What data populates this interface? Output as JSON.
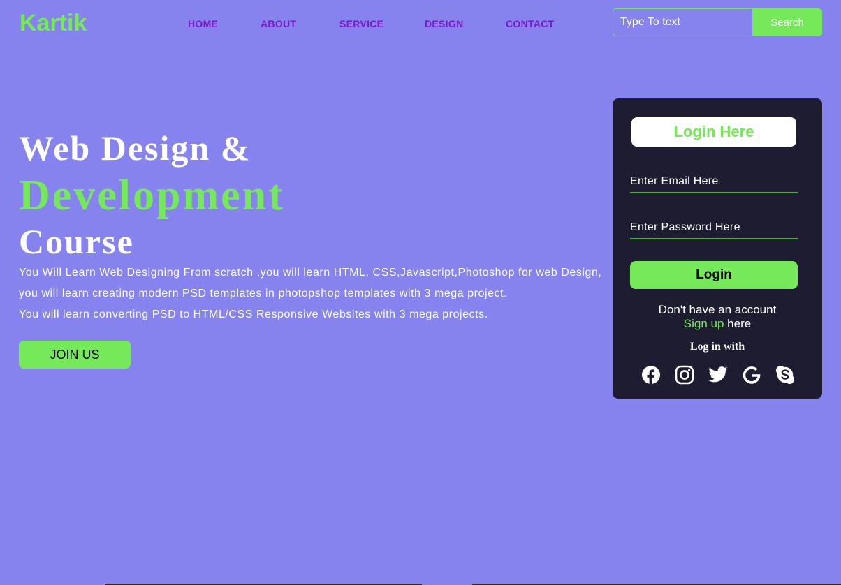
{
  "brand": {
    "logo": "Kartik"
  },
  "nav": {
    "items": [
      {
        "label": "HOME"
      },
      {
        "label": "ABOUT"
      },
      {
        "label": "SERVICE"
      },
      {
        "label": "DESIGN"
      },
      {
        "label": "CONTACT"
      }
    ]
  },
  "search": {
    "placeholder": "Type To text",
    "button_label": "Search"
  },
  "hero": {
    "line1": "Web Design &",
    "line2": "Development",
    "line3": "Course",
    "description": [
      "You Will Learn Web Designing From scratch ,you will learn HTML, CSS,Javascript,Photoshop for web Design,",
      "you will learn creating modern PSD templates in photopshop templates with 3 mega project.",
      "You will learn converting PSD to HTML/CSS Responsive Websites with 3 mega projects."
    ],
    "join_label": "JOIN US"
  },
  "login": {
    "title": "Login Here",
    "email_placeholder": "Enter Email Here",
    "password_placeholder": "Enter Password Here",
    "button_label": "Login",
    "no_account_text": "Don't have an account",
    "signup_link": "Sign up",
    "signup_suffix": " here",
    "login_with": "Log in with",
    "social_icons": [
      "facebook-icon",
      "instagram-icon",
      "twitter-icon",
      "google-icon",
      "skype-icon"
    ]
  },
  "colors": {
    "background": "#8783ee",
    "accent": "#76e95b",
    "nav_text": "#7a19c6",
    "panel": "#1e1c30"
  }
}
